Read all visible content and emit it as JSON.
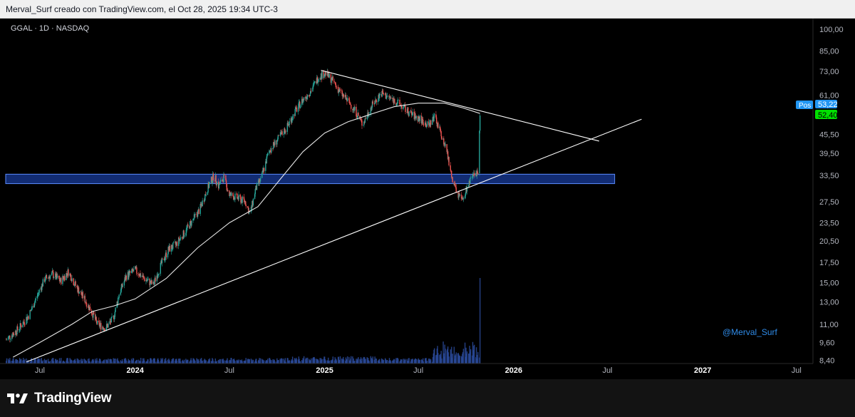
{
  "header": {
    "attribution": "Merval_Surf creado con TradingView.com, el Oct 28, 2025 19:34 UTC-3"
  },
  "symbol": {
    "label": "GGAL · 1D · NASDAQ"
  },
  "watermark": {
    "handle": "@Merval_Surf"
  },
  "footer": {
    "brand": "TradingView"
  },
  "badges": {
    "pos_label": "Pos",
    "pos_value": "53,22",
    "last_price": "52,40"
  },
  "colors": {
    "up": "#26a69a",
    "down": "#ef5350",
    "zone": "#2962ff",
    "trendline": "#ffffff",
    "ma": "#ffffff",
    "volume": "#2a4a9a",
    "pos_badge": "#2196f3",
    "price_badge": "#00e000"
  },
  "chart_data": {
    "type": "candlestick",
    "ticker": "GGAL",
    "interval": "1D",
    "exchange": "NASDAQ",
    "y_scale": "log",
    "y_tick_labels": [
      "100,00",
      "85,00",
      "73,00",
      "61,00",
      "53,22",
      "52,40",
      "45,50",
      "39,50",
      "33,50",
      "27,50",
      "23,50",
      "20,50",
      "17,50",
      "15,00",
      "13,00",
      "11,00",
      "9,60",
      "8,40"
    ],
    "y_ticks": [
      100,
      85,
      73,
      61,
      45.5,
      39.5,
      33.5,
      27.5,
      23.5,
      20.5,
      17.5,
      15,
      13,
      11,
      9.6,
      8.4
    ],
    "ylim": [
      8.2,
      106
    ],
    "x_tick_labels": [
      "Jul",
      "2024",
      "Jul",
      "2025",
      "Jul",
      "2026",
      "Jul",
      "2027",
      "Jul"
    ],
    "x_ticks": [
      "2023-07-01",
      "2024-01-01",
      "2024-07-01",
      "2025-01-01",
      "2025-07-01",
      "2026-01-01",
      "2026-07-01",
      "2027-01-01",
      "2027-07-01"
    ],
    "xlim": [
      "2023-04-26",
      "2027-08-02"
    ],
    "price_path": [
      [
        "2023-04-27",
        9.8
      ],
      [
        "2023-05-20",
        10.6
      ],
      [
        "2023-06-10",
        11.8
      ],
      [
        "2023-06-25",
        13.5
      ],
      [
        "2023-07-10",
        15.4
      ],
      [
        "2023-07-25",
        16.0
      ],
      [
        "2023-08-10",
        15.2
      ],
      [
        "2023-08-25",
        16.3
      ],
      [
        "2023-09-10",
        14.5
      ],
      [
        "2023-09-25",
        13.3
      ],
      [
        "2023-10-10",
        12.0
      ],
      [
        "2023-10-20",
        11.0
      ],
      [
        "2023-11-05",
        10.7
      ],
      [
        "2023-11-20",
        11.5
      ],
      [
        "2023-12-01",
        13.8
      ],
      [
        "2023-12-15",
        15.8
      ],
      [
        "2024-01-01",
        16.5
      ],
      [
        "2024-01-20",
        15.4
      ],
      [
        "2024-02-05",
        14.8
      ],
      [
        "2024-02-20",
        17.2
      ],
      [
        "2024-03-05",
        19.2
      ],
      [
        "2024-03-20",
        20.0
      ],
      [
        "2024-04-05",
        21.8
      ],
      [
        "2024-04-20",
        23.8
      ],
      [
        "2024-05-05",
        26.0
      ],
      [
        "2024-05-20",
        30.5
      ],
      [
        "2024-06-01",
        33.5
      ],
      [
        "2024-06-10",
        31.0
      ],
      [
        "2024-06-20",
        33.0
      ],
      [
        "2024-07-01",
        29.0
      ],
      [
        "2024-07-15",
        28.4
      ],
      [
        "2024-08-01",
        27.5
      ],
      [
        "2024-08-10",
        25.0
      ],
      [
        "2024-08-20",
        30.0
      ],
      [
        "2024-09-01",
        33.0
      ],
      [
        "2024-09-15",
        40.0
      ],
      [
        "2024-10-01",
        43.5
      ],
      [
        "2024-10-20",
        48.0
      ],
      [
        "2024-11-05",
        54.0
      ],
      [
        "2024-11-20",
        59.0
      ],
      [
        "2024-12-05",
        63.0
      ],
      [
        "2024-12-20",
        70.0
      ],
      [
        "2025-01-02",
        72.0
      ],
      [
        "2025-01-15",
        68.5
      ],
      [
        "2025-02-01",
        62.0
      ],
      [
        "2025-02-20",
        57.0
      ],
      [
        "2025-03-05",
        53.0
      ],
      [
        "2025-03-15",
        49.0
      ],
      [
        "2025-04-01",
        56.0
      ],
      [
        "2025-04-20",
        62.0
      ],
      [
        "2025-05-05",
        60.0
      ],
      [
        "2025-05-20",
        58.0
      ],
      [
        "2025-06-05",
        55.0
      ],
      [
        "2025-06-20",
        52.5
      ],
      [
        "2025-07-05",
        51.0
      ],
      [
        "2025-07-20",
        48.5
      ],
      [
        "2025-08-01",
        52.0
      ],
      [
        "2025-08-15",
        45.0
      ],
      [
        "2025-08-25",
        40.0
      ],
      [
        "2025-09-05",
        32.0
      ],
      [
        "2025-09-15",
        29.0
      ],
      [
        "2025-09-25",
        27.5
      ],
      [
        "2025-10-05",
        31.5
      ],
      [
        "2025-10-15",
        33.0
      ],
      [
        "2025-10-24",
        35.0
      ],
      [
        "2025-10-28",
        52.4
      ]
    ],
    "moving_average": [
      [
        "2023-05-10",
        8.6
      ],
      [
        "2023-07-01",
        9.6
      ],
      [
        "2023-09-01",
        11.0
      ],
      [
        "2023-10-10",
        12.1
      ],
      [
        "2023-11-20",
        12.6
      ],
      [
        "2024-01-01",
        13.3
      ],
      [
        "2024-03-01",
        15.5
      ],
      [
        "2024-05-01",
        19.5
      ],
      [
        "2024-07-01",
        23.5
      ],
      [
        "2024-08-25",
        26.5
      ],
      [
        "2024-10-10",
        33.0
      ],
      [
        "2024-11-20",
        40.0
      ],
      [
        "2025-01-01",
        46.0
      ],
      [
        "2025-02-15",
        50.0
      ],
      [
        "2025-04-01",
        53.0
      ],
      [
        "2025-05-15",
        56.0
      ],
      [
        "2025-07-01",
        57.5
      ],
      [
        "2025-08-20",
        57.5
      ],
      [
        "2025-09-25",
        55.5
      ],
      [
        "2025-10-28",
        53.22
      ]
    ],
    "annotations": {
      "support_zone": {
        "low": 31.5,
        "high": 33.8,
        "from": "2023-04-26",
        "to": "2026-07-15"
      },
      "ascending_trendline": [
        [
          "2023-06-05",
          8.3
        ],
        [
          "2026-09-05",
          51.0
        ]
      ],
      "descending_trendline": [
        [
          "2024-12-25",
          73.5
        ],
        [
          "2026-06-15",
          43.3
        ]
      ]
    },
    "last_price": 52.4,
    "moving_average_last": 53.22
  }
}
